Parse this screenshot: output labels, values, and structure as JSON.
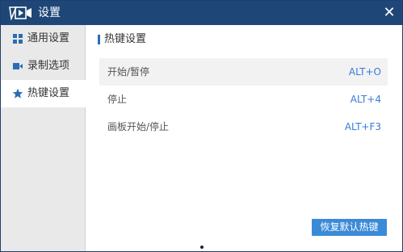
{
  "window": {
    "title": "设置",
    "accent": "#1e4677"
  },
  "sidebar": {
    "items": [
      {
        "label": "通用设置",
        "icon": "grid-icon",
        "active": false
      },
      {
        "label": "录制选项",
        "icon": "video-camera-icon",
        "active": false
      },
      {
        "label": "热键设置",
        "icon": "star-icon",
        "active": true
      }
    ]
  },
  "content": {
    "section_title": "热键设置",
    "hotkeys": [
      {
        "name": "开始/暂停",
        "key": "ALT+O"
      },
      {
        "name": "停止",
        "key": "ALT+4"
      },
      {
        "name": "画板开始/停止",
        "key": "ALT+F3"
      }
    ],
    "restore_label": "恢复默认热键"
  },
  "colors": {
    "titlebar": "#1e4677",
    "link": "#3a7bd5",
    "button": "#3b8ad8"
  }
}
